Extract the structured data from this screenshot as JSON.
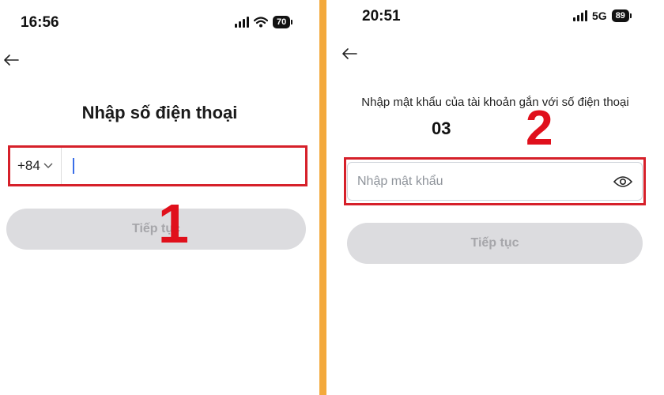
{
  "left_screen": {
    "status_time": "16:56",
    "battery": "70",
    "back_icon": "arrow-left-icon",
    "title": "Nhập số điện thoại",
    "country_code": "+84",
    "continue_label": "Tiếp tục",
    "step_marker": "1"
  },
  "right_screen": {
    "status_time": "20:51",
    "network": "5G",
    "battery": "89",
    "back_icon": "arrow-left-icon",
    "subtitle": "Nhập mật khẩu của tài khoản gắn với số điện thoại",
    "phone_number": "03",
    "password_placeholder": "Nhập mật khẩu",
    "eye_icon": "eye-icon",
    "continue_label": "Tiếp tục",
    "step_marker": "2"
  },
  "colors": {
    "highlight": "#d6202a",
    "marker": "#e0101c",
    "divider": "#f3a93c",
    "disabled_button": "#dcdcdf",
    "cursor": "#3a6ee8"
  }
}
